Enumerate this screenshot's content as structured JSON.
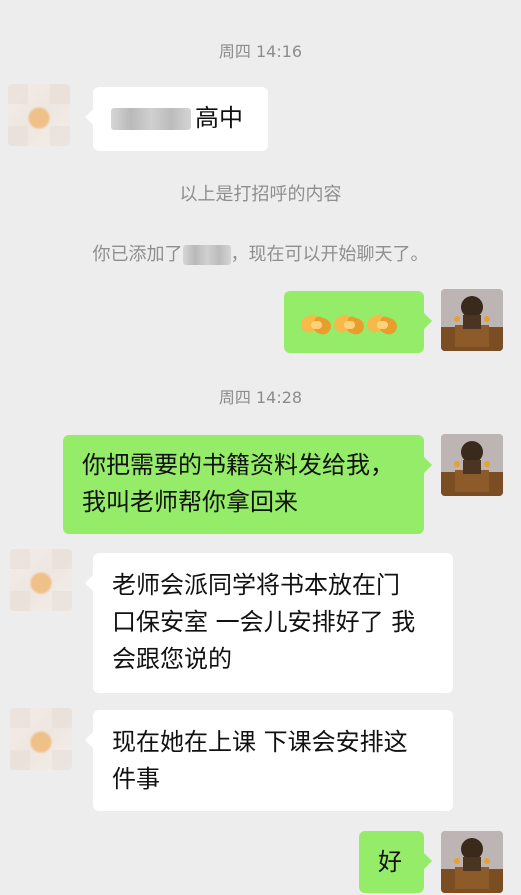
{
  "messages": {
    "timestamp_1": "周四 14:16",
    "greeting_suffix": "高中",
    "system_greeting_note": "以上是打招呼的内容",
    "system_added_prefix": "你已添加了",
    "system_added_suffix": "，现在可以开始聊天了。",
    "handshake_emoji_alt": "🤝🤝🤝",
    "timestamp_2": "周四 14:28",
    "outgoing_request_line1": "你把需要的书籍资料发给我，",
    "outgoing_request_line2": "我叫老师帮你拿回来",
    "reply_1_line1": "老师会派同学将书本放在门",
    "reply_1_line2": "口保安室 一会儿安排好了 我",
    "reply_1_line3": "会跟您说的",
    "reply_2_line1": "现在她在上课 下课会安排这",
    "reply_2_line2": "件事",
    "outgoing_ok": "好"
  },
  "colors": {
    "background": "#ededed",
    "bubble_outgoing": "#95ec69",
    "bubble_incoming": "#ffffff",
    "system_text": "#8f8f8f"
  },
  "icons": {
    "handshake": "handshake-emoji",
    "contact_avatar": "blurred-avatar",
    "self_avatar": "photo-avatar"
  }
}
